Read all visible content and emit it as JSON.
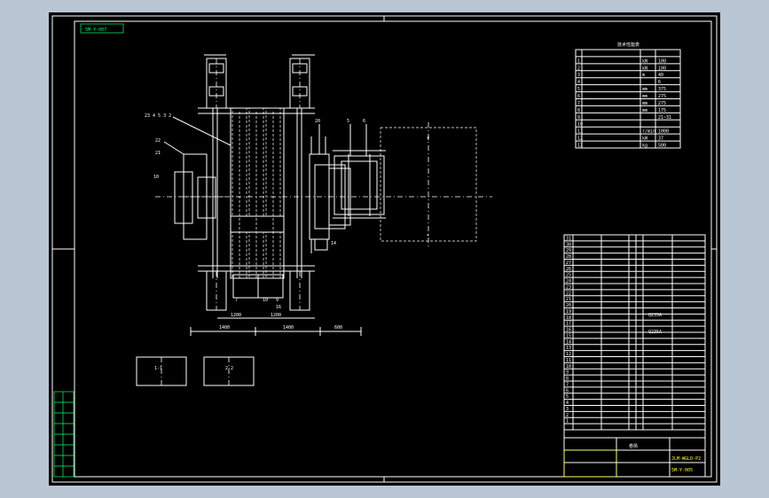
{
  "drawing": {
    "tag_code": "5M-Y-007",
    "tech_table_title": "技术性能表",
    "tech_rows": [
      {
        "no": "1",
        "unit": "kN",
        "val": "100"
      },
      {
        "no": "2",
        "unit": "kN",
        "val": "100"
      },
      {
        "no": "3",
        "unit": "m",
        "val": "40"
      },
      {
        "no": "4",
        "unit": "",
        "val": "6"
      },
      {
        "no": "5",
        "unit": "mm",
        "val": "375"
      },
      {
        "no": "6",
        "unit": "mm",
        "val": "275"
      },
      {
        "no": "7",
        "unit": "mm",
        "val": "275"
      },
      {
        "no": "8",
        "unit": "mm",
        "val": "175"
      },
      {
        "no": "9",
        "unit": "",
        "val": "21~31"
      },
      {
        "no": "10",
        "unit": "",
        "val": ""
      },
      {
        "no": "11",
        "unit": "r/min",
        "val": "1000"
      },
      {
        "no": "12",
        "unit": "kW",
        "val": "37"
      },
      {
        "no": "13",
        "unit": "kg",
        "val": "500"
      }
    ],
    "bom_codes": [
      "Q235A",
      "Q235A"
    ],
    "bom_row_numbers": [
      "31",
      "30",
      "29",
      "28",
      "27",
      "26",
      "25",
      "24",
      "23",
      "22",
      "21",
      "20",
      "19",
      "18",
      "17",
      "16",
      "15",
      "14",
      "13",
      "12",
      "11",
      "10",
      "9",
      "8",
      "7",
      "6",
      "5",
      "4",
      "3",
      "2",
      "1"
    ],
    "title_block_code": "5M-Y-005",
    "title_block_ref": "JLM-WGLD-P2",
    "title_block_name": "卷扬",
    "dim_labels": [
      "1400",
      "1400",
      "600",
      "1200",
      "1200"
    ],
    "section_labels": [
      "1-1",
      "2-2"
    ],
    "part_labels": [
      "23",
      "4",
      "5",
      "3",
      "2",
      "22",
      "21",
      "20",
      "19",
      "18",
      "17",
      "16",
      "15",
      "14",
      "10",
      "9",
      "8",
      "7",
      "6",
      "5"
    ],
    "left_stamp_labels": [
      "借(通)用件",
      "描 图",
      "校 对",
      "旧底图总号",
      "底图总号",
      "签 字",
      "日 期"
    ]
  }
}
